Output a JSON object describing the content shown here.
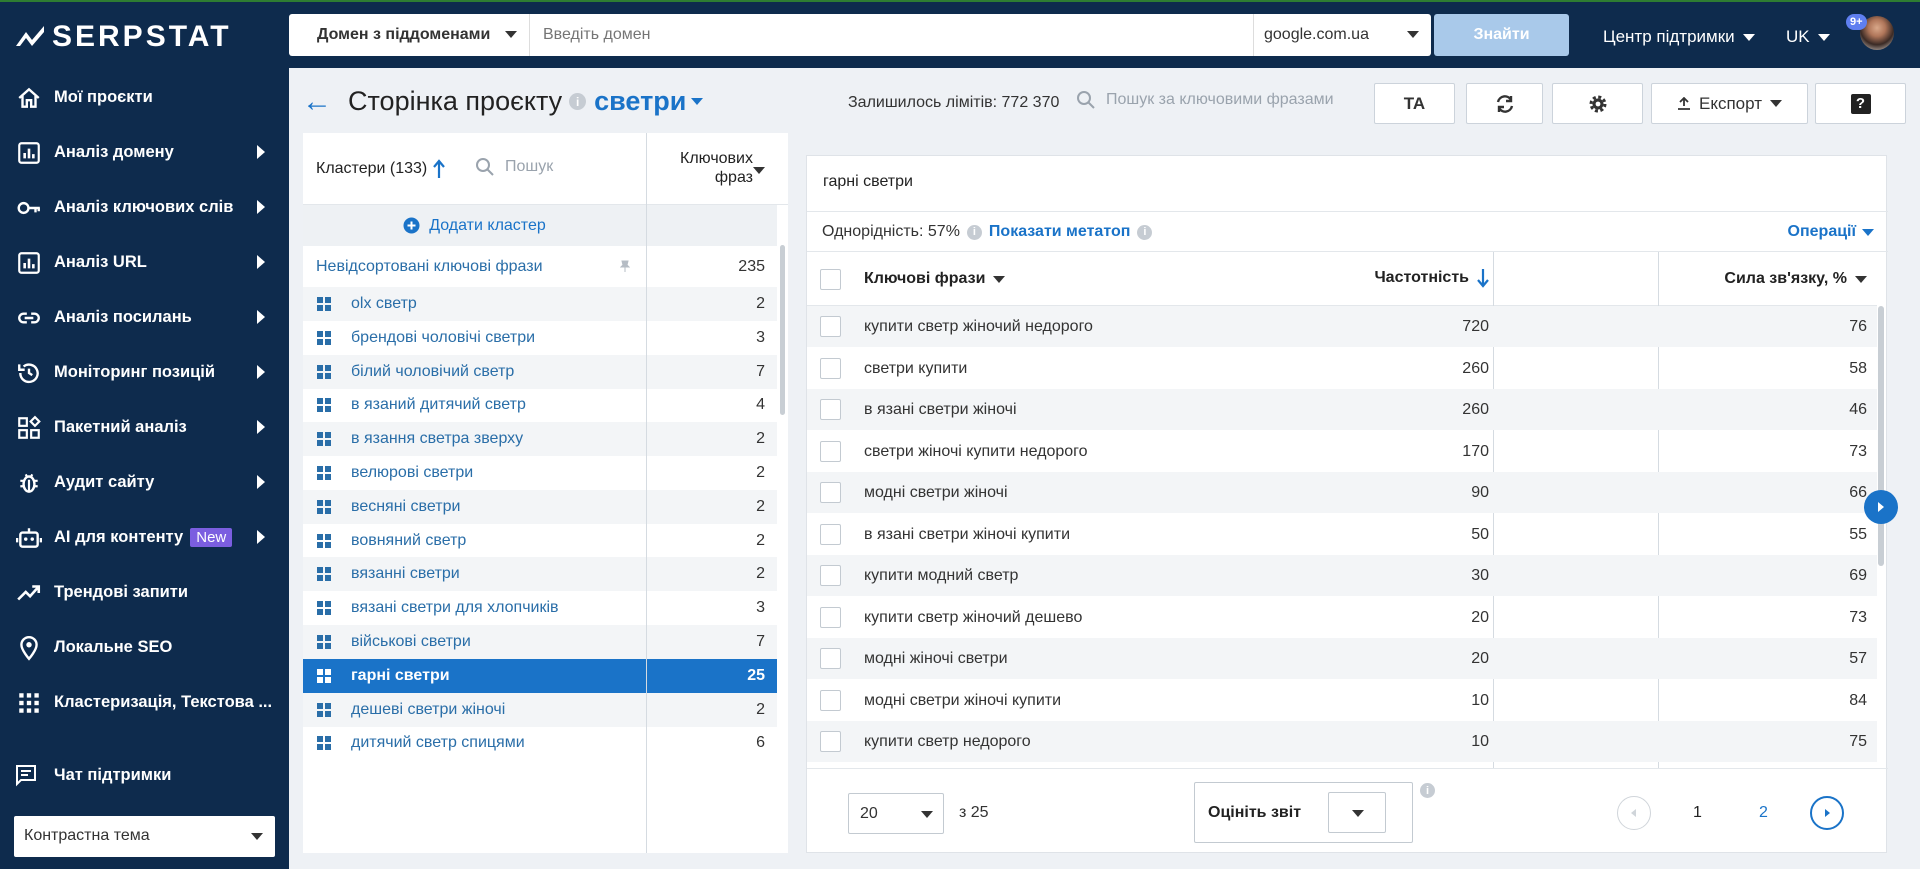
{
  "brand": {
    "name": "SERPSTAT",
    "accent": "#1a73c8",
    "sidebar_bg": "#0e2b4d"
  },
  "nav": [
    {
      "label": "Мої проєкти",
      "icon": "home-icon",
      "arrow": false
    },
    {
      "label": "Аналіз домену",
      "icon": "chart-icon",
      "arrow": true
    },
    {
      "label": "Аналіз ключових слів",
      "icon": "key-icon",
      "arrow": true
    },
    {
      "label": "Аналіз URL",
      "icon": "chart-icon",
      "arrow": true
    },
    {
      "label": "Аналіз посилань",
      "icon": "link-icon",
      "arrow": true
    },
    {
      "label": "Моніторинг позицій",
      "icon": "history-icon",
      "arrow": true
    },
    {
      "label": "Пакетний аналіз",
      "icon": "batch-icon",
      "arrow": true
    },
    {
      "label": "Аудит сайту",
      "icon": "bug-icon",
      "arrow": true
    },
    {
      "label": "AI для контенту",
      "icon": "robot-icon",
      "arrow": true,
      "badge": "New"
    },
    {
      "label": "Трендові запити",
      "icon": "trend-icon",
      "arrow": false
    },
    {
      "label": "Локальне SEO",
      "icon": "pin-icon",
      "arrow": false
    },
    {
      "label": "Кластеризація, Текстова ...",
      "icon": "apps-icon",
      "arrow": false
    }
  ],
  "sidebar": {
    "chat": "Чат підтримки",
    "theme": "Контрастна тема"
  },
  "topbar": {
    "domain_select": "Домен з піддоменами",
    "domain_placeholder": "Введіть домен",
    "search_engine": "google.com.ua",
    "find": "Знайти",
    "support": "Центр підтримки",
    "lang": "UK",
    "notifications": "9+"
  },
  "header": {
    "title": "Сторінка проєкту",
    "project": "светри",
    "limits": "Залишилось лімітів: 772 370",
    "kw_search_placeholder": "Пошук за ключовими фразами",
    "ta": "TA",
    "export": "Експорт",
    "help": "?"
  },
  "clusters": {
    "header": "Кластери (133)",
    "search_placeholder": "Пошук",
    "col_keywords": "Ключових фраз",
    "add": "Додати кластер",
    "unsorted": {
      "name": "Невідсортовані ключові фрази",
      "count": "235"
    },
    "items": [
      {
        "name": "olx светр",
        "count": "2"
      },
      {
        "name": "брендові чоловічі светри",
        "count": "3"
      },
      {
        "name": "білий чоловічий светр",
        "count": "7"
      },
      {
        "name": "в язаний дитячий светр",
        "count": "4"
      },
      {
        "name": "в язання светра зверху",
        "count": "2"
      },
      {
        "name": "велюрові светри",
        "count": "2"
      },
      {
        "name": "весняні светри",
        "count": "2"
      },
      {
        "name": "вовняний светр",
        "count": "2"
      },
      {
        "name": "вязанні светри",
        "count": "2"
      },
      {
        "name": "вязані светри для хлопчиків",
        "count": "3"
      },
      {
        "name": "військові светри",
        "count": "7"
      },
      {
        "name": "гарні светри",
        "count": "25",
        "selected": true
      },
      {
        "name": "дешеві светри жіночі",
        "count": "2"
      },
      {
        "name": "дитячий светр спицями",
        "count": "6"
      }
    ]
  },
  "detail": {
    "title": "гарні светри",
    "homogeneity": "Однорідність: 57%",
    "show_meta": "Показати метатоп",
    "operations": "Операції",
    "col_kw": "Ключові фрази",
    "col_freq": "Частотність",
    "col_strength": "Сила зв'язку, %",
    "rows": [
      {
        "kw": "купити светр жіночий недорого",
        "freq": "720",
        "strength": "76"
      },
      {
        "kw": "светри купити",
        "freq": "260",
        "strength": "58"
      },
      {
        "kw": "в язані светри жіночі",
        "freq": "260",
        "strength": "46"
      },
      {
        "kw": "светри жіночі купити недорого",
        "freq": "170",
        "strength": "73"
      },
      {
        "kw": "модні светри жіночі",
        "freq": "90",
        "strength": "66"
      },
      {
        "kw": "в язані светри жіночі купити",
        "freq": "50",
        "strength": "55"
      },
      {
        "kw": "купити модний светр",
        "freq": "30",
        "strength": "69"
      },
      {
        "kw": "купити светр жіночий дешево",
        "freq": "20",
        "strength": "73"
      },
      {
        "kw": "модні жіночі светри",
        "freq": "20",
        "strength": "57"
      },
      {
        "kw": "модні светри жіночі купити",
        "freq": "10",
        "strength": "84"
      },
      {
        "kw": "купити светр недорого",
        "freq": "10",
        "strength": "75"
      }
    ],
    "per_page": "20",
    "of_total": "з 25",
    "rate": "Оцініть звіт",
    "pages": [
      "1",
      "2"
    ]
  }
}
